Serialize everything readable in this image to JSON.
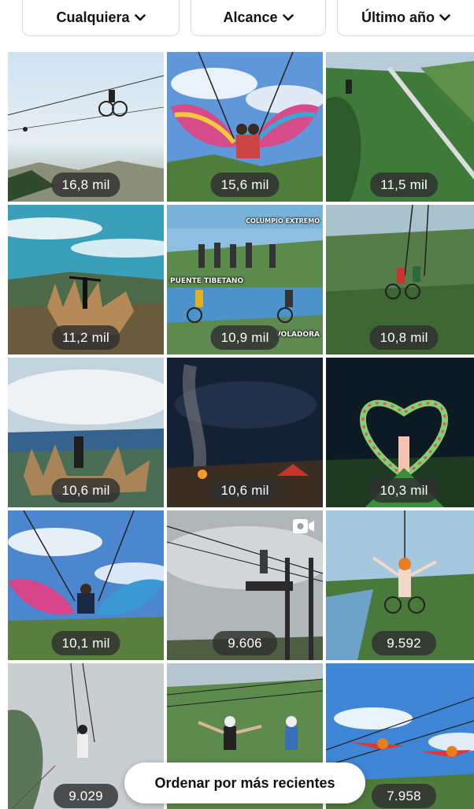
{
  "filters": [
    {
      "label": "Cualquiera"
    },
    {
      "label": "Alcance"
    },
    {
      "label": "Último año"
    }
  ],
  "grid": {
    "tiles": [
      {
        "count": "16,8 mil"
      },
      {
        "count": "15,6 mil"
      },
      {
        "count": "11,5 mil"
      },
      {
        "count": "11,2 mil"
      },
      {
        "count": "10,9 mil",
        "overlays": [
          "COLUMPIO EXTREMO",
          "PUENTE TIBETANO",
          "VOLADORA"
        ]
      },
      {
        "count": "10,8 mil"
      },
      {
        "count": "10,6 mil"
      },
      {
        "count": "10,6 mil"
      },
      {
        "count": "10,3 mil"
      },
      {
        "count": "10,1 mil"
      },
      {
        "count": "9.606",
        "icon": "video-camera-icon"
      },
      {
        "count": "9.592"
      },
      {
        "count": "9.029"
      },
      {
        "count": ""
      },
      {
        "count": "7.958"
      }
    ]
  },
  "sort": {
    "label": "Ordenar por más recientes"
  },
  "colors": {
    "badge": "#303030",
    "sky": "#8fb8e6",
    "forest": "#3f7a3a"
  }
}
